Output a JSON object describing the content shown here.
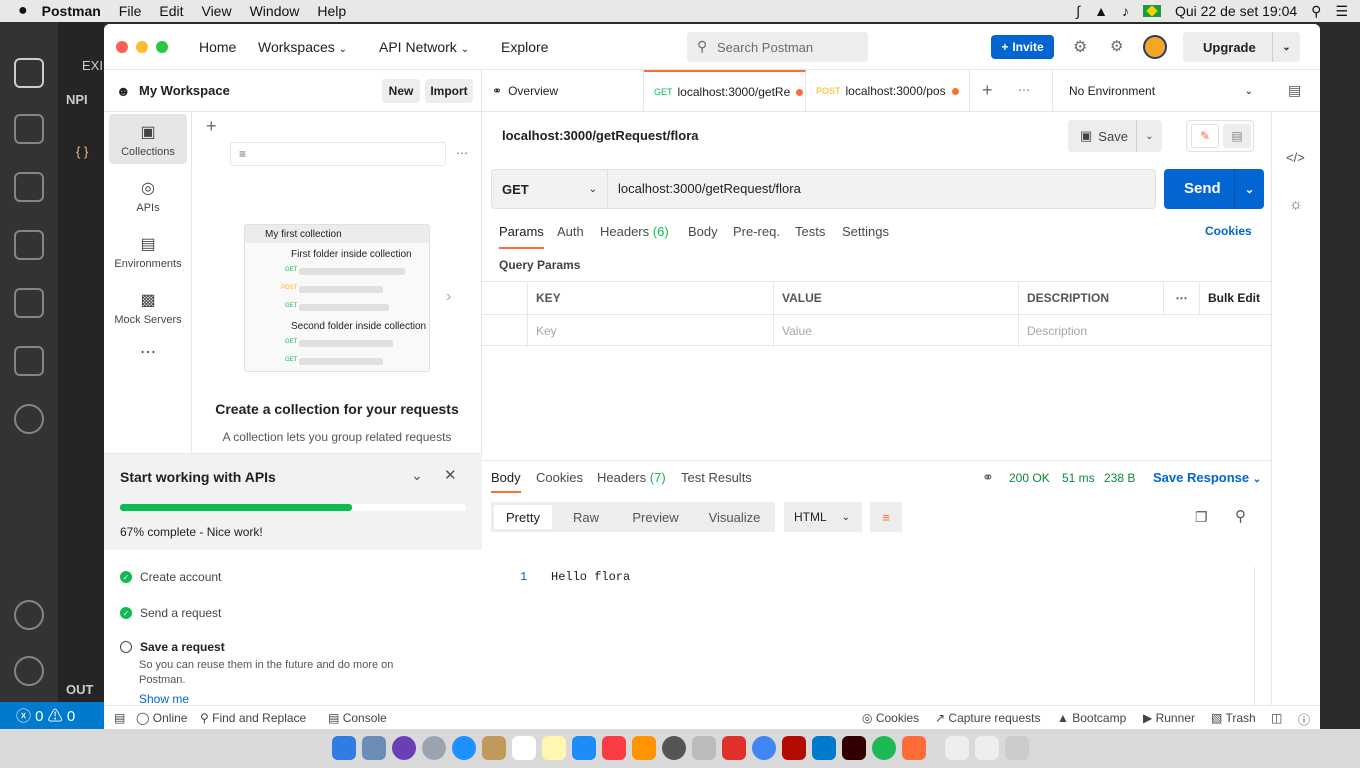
{
  "menubar": {
    "app": "Postman",
    "items": [
      "File",
      "Edit",
      "View",
      "Window",
      "Help"
    ],
    "datetime": "Qui 22 de set  19:04"
  },
  "vscode": {
    "explorer_partial": "EXI",
    "npm_partial": "NPI",
    "outline_partial": "OUT",
    "status": "ⓧ 0 ⚠ 0"
  },
  "topbar": {
    "nav": [
      "Home",
      "Workspaces",
      "API Network",
      "Explore"
    ],
    "search_placeholder": "Search Postman",
    "invite": "Invite",
    "upgrade": "Upgrade"
  },
  "workspace": {
    "title": "My Workspace",
    "new_label": "New",
    "import_label": "Import"
  },
  "sidebar": {
    "items": [
      {
        "label": "Collections",
        "icon": "collections-icon"
      },
      {
        "label": "APIs",
        "icon": "apis-icon"
      },
      {
        "label": "Environments",
        "icon": "environments-icon"
      },
      {
        "label": "Mock Servers",
        "icon": "mock-servers-icon"
      }
    ]
  },
  "illustration": {
    "collection": "My first collection",
    "folder1": "First folder inside collection",
    "folder2": "Second folder inside collection",
    "m_get": "GET",
    "m_post": "POST"
  },
  "empty_state": {
    "title": "Create a collection for your requests",
    "desc": "A collection lets you group related requests"
  },
  "onboarding": {
    "title": "Start working with APIs",
    "progress_text": "67% complete - Nice work!",
    "progress": 0.67,
    "steps": [
      {
        "label": "Create account",
        "done": true
      },
      {
        "label": "Send a request",
        "done": true
      },
      {
        "label": "Save a request",
        "done": false
      }
    ],
    "save_desc": "So you can reuse them in the future and do more on Postman.",
    "show_me": "Show me"
  },
  "tabs": {
    "overview": "Overview",
    "tab1_method": "GET",
    "tab1_label": "localhost:3000/getRe",
    "tab2_method": "POST",
    "tab2_label": "localhost:3000/pos",
    "environment": "No Environment"
  },
  "request": {
    "name": "localhost:3000/getRequest/flora",
    "save": "Save",
    "method": "GET",
    "url": "localhost:3000/getRequest/flora",
    "send": "Send",
    "tabs": [
      "Params",
      "Auth",
      "Headers",
      "Body",
      "Pre-req.",
      "Tests",
      "Settings"
    ],
    "headers_count": "(6)",
    "cookies": "Cookies",
    "query_params": "Query Params",
    "table": {
      "headers": [
        "KEY",
        "VALUE",
        "DESCRIPTION"
      ],
      "bulk_edit": "Bulk Edit",
      "placeholders": [
        "Key",
        "Value",
        "Description"
      ]
    }
  },
  "response": {
    "tabs": [
      "Body",
      "Cookies",
      "Headers",
      "Test Results"
    ],
    "headers_count": "(7)",
    "status": "200 OK",
    "time": "51 ms",
    "size": "238 B",
    "save_response": "Save Response",
    "views": [
      "Pretty",
      "Raw",
      "Preview",
      "Visualize"
    ],
    "format": "HTML",
    "line_no": "1",
    "body": "Hello flora"
  },
  "footer": {
    "online": "Online",
    "find_replace": "Find and Replace",
    "console": "Console",
    "cookies": "Cookies",
    "capture": "Capture requests",
    "bootcamp": "Bootcamp",
    "runner": "Runner",
    "trash": "Trash"
  },
  "colors": {
    "accent": "#ff6c37",
    "primary": "#0265d2",
    "success": "#0cbb52"
  }
}
